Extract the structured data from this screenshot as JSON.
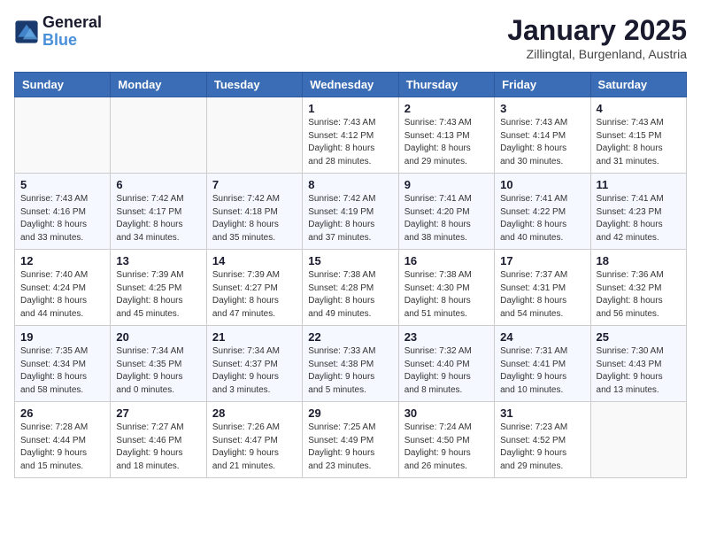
{
  "header": {
    "logo_line1": "General",
    "logo_line2": "Blue",
    "title": "January 2025",
    "subtitle": "Zillingtal, Burgenland, Austria"
  },
  "weekdays": [
    "Sunday",
    "Monday",
    "Tuesday",
    "Wednesday",
    "Thursday",
    "Friday",
    "Saturday"
  ],
  "weeks": [
    [
      {
        "day": "",
        "info": ""
      },
      {
        "day": "",
        "info": ""
      },
      {
        "day": "",
        "info": ""
      },
      {
        "day": "1",
        "info": "Sunrise: 7:43 AM\nSunset: 4:12 PM\nDaylight: 8 hours\nand 28 minutes."
      },
      {
        "day": "2",
        "info": "Sunrise: 7:43 AM\nSunset: 4:13 PM\nDaylight: 8 hours\nand 29 minutes."
      },
      {
        "day": "3",
        "info": "Sunrise: 7:43 AM\nSunset: 4:14 PM\nDaylight: 8 hours\nand 30 minutes."
      },
      {
        "day": "4",
        "info": "Sunrise: 7:43 AM\nSunset: 4:15 PM\nDaylight: 8 hours\nand 31 minutes."
      }
    ],
    [
      {
        "day": "5",
        "info": "Sunrise: 7:43 AM\nSunset: 4:16 PM\nDaylight: 8 hours\nand 33 minutes."
      },
      {
        "day": "6",
        "info": "Sunrise: 7:42 AM\nSunset: 4:17 PM\nDaylight: 8 hours\nand 34 minutes."
      },
      {
        "day": "7",
        "info": "Sunrise: 7:42 AM\nSunset: 4:18 PM\nDaylight: 8 hours\nand 35 minutes."
      },
      {
        "day": "8",
        "info": "Sunrise: 7:42 AM\nSunset: 4:19 PM\nDaylight: 8 hours\nand 37 minutes."
      },
      {
        "day": "9",
        "info": "Sunrise: 7:41 AM\nSunset: 4:20 PM\nDaylight: 8 hours\nand 38 minutes."
      },
      {
        "day": "10",
        "info": "Sunrise: 7:41 AM\nSunset: 4:22 PM\nDaylight: 8 hours\nand 40 minutes."
      },
      {
        "day": "11",
        "info": "Sunrise: 7:41 AM\nSunset: 4:23 PM\nDaylight: 8 hours\nand 42 minutes."
      }
    ],
    [
      {
        "day": "12",
        "info": "Sunrise: 7:40 AM\nSunset: 4:24 PM\nDaylight: 8 hours\nand 44 minutes."
      },
      {
        "day": "13",
        "info": "Sunrise: 7:39 AM\nSunset: 4:25 PM\nDaylight: 8 hours\nand 45 minutes."
      },
      {
        "day": "14",
        "info": "Sunrise: 7:39 AM\nSunset: 4:27 PM\nDaylight: 8 hours\nand 47 minutes."
      },
      {
        "day": "15",
        "info": "Sunrise: 7:38 AM\nSunset: 4:28 PM\nDaylight: 8 hours\nand 49 minutes."
      },
      {
        "day": "16",
        "info": "Sunrise: 7:38 AM\nSunset: 4:30 PM\nDaylight: 8 hours\nand 51 minutes."
      },
      {
        "day": "17",
        "info": "Sunrise: 7:37 AM\nSunset: 4:31 PM\nDaylight: 8 hours\nand 54 minutes."
      },
      {
        "day": "18",
        "info": "Sunrise: 7:36 AM\nSunset: 4:32 PM\nDaylight: 8 hours\nand 56 minutes."
      }
    ],
    [
      {
        "day": "19",
        "info": "Sunrise: 7:35 AM\nSunset: 4:34 PM\nDaylight: 8 hours\nand 58 minutes."
      },
      {
        "day": "20",
        "info": "Sunrise: 7:34 AM\nSunset: 4:35 PM\nDaylight: 9 hours\nand 0 minutes."
      },
      {
        "day": "21",
        "info": "Sunrise: 7:34 AM\nSunset: 4:37 PM\nDaylight: 9 hours\nand 3 minutes."
      },
      {
        "day": "22",
        "info": "Sunrise: 7:33 AM\nSunset: 4:38 PM\nDaylight: 9 hours\nand 5 minutes."
      },
      {
        "day": "23",
        "info": "Sunrise: 7:32 AM\nSunset: 4:40 PM\nDaylight: 9 hours\nand 8 minutes."
      },
      {
        "day": "24",
        "info": "Sunrise: 7:31 AM\nSunset: 4:41 PM\nDaylight: 9 hours\nand 10 minutes."
      },
      {
        "day": "25",
        "info": "Sunrise: 7:30 AM\nSunset: 4:43 PM\nDaylight: 9 hours\nand 13 minutes."
      }
    ],
    [
      {
        "day": "26",
        "info": "Sunrise: 7:28 AM\nSunset: 4:44 PM\nDaylight: 9 hours\nand 15 minutes."
      },
      {
        "day": "27",
        "info": "Sunrise: 7:27 AM\nSunset: 4:46 PM\nDaylight: 9 hours\nand 18 minutes."
      },
      {
        "day": "28",
        "info": "Sunrise: 7:26 AM\nSunset: 4:47 PM\nDaylight: 9 hours\nand 21 minutes."
      },
      {
        "day": "29",
        "info": "Sunrise: 7:25 AM\nSunset: 4:49 PM\nDaylight: 9 hours\nand 23 minutes."
      },
      {
        "day": "30",
        "info": "Sunrise: 7:24 AM\nSunset: 4:50 PM\nDaylight: 9 hours\nand 26 minutes."
      },
      {
        "day": "31",
        "info": "Sunrise: 7:23 AM\nSunset: 4:52 PM\nDaylight: 9 hours\nand 29 minutes."
      },
      {
        "day": "",
        "info": ""
      }
    ]
  ]
}
